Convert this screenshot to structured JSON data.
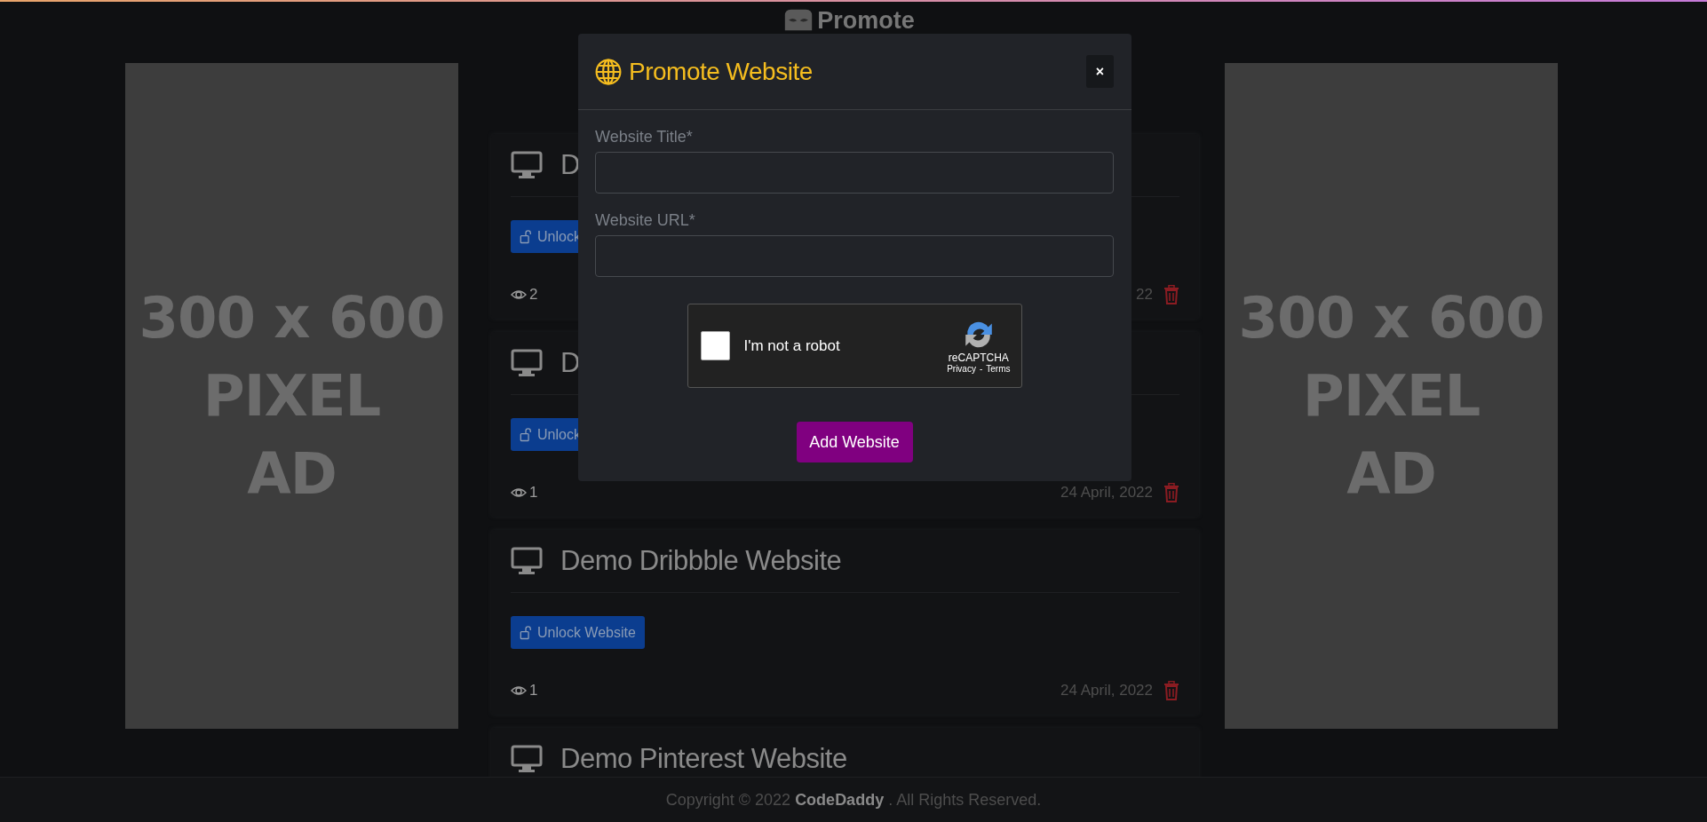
{
  "header": {
    "logo_text": "Promote"
  },
  "ads": [
    {
      "lines": [
        "300 x 600",
        "PIXEL",
        "AD"
      ]
    },
    {
      "lines": [
        "300 x 600",
        "PIXEL",
        "AD"
      ]
    }
  ],
  "websites": [
    {
      "title": "D",
      "button": "Unlock",
      "views": "2",
      "date": "22"
    },
    {
      "title": "D",
      "button": "Unlock",
      "views": "1",
      "date": "24 April, 2022"
    },
    {
      "title": "Demo Dribbble Website",
      "button": "Unlock Website",
      "views": "1",
      "date": "24 April, 2022"
    },
    {
      "title": "Demo Pinterest Website"
    }
  ],
  "modal": {
    "title": "Promote Website",
    "close": "×",
    "fields": [
      {
        "label": "Website Title*"
      },
      {
        "label": "Website URL*"
      }
    ],
    "captcha": {
      "label": "I'm not a robot",
      "checked": false,
      "brand": "reCAPTCHA",
      "links": [
        "Privacy",
        "Terms"
      ],
      "separator": "-"
    },
    "submit": "Add Website"
  },
  "footer": "Copyright © 2022 **CodeDaddy** . All Rights Reserved."
}
